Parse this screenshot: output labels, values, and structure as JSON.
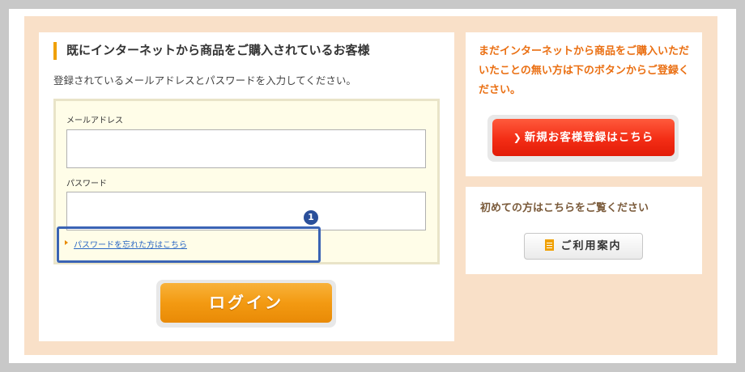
{
  "login": {
    "heading": "既にインターネットから商品をご購入されているお客様",
    "instruction": "登録されているメールアドレスとパスワードを入力してください。",
    "email_label": "メールアドレス",
    "email_value": "",
    "password_label": "パスワード",
    "password_value": "",
    "forgot_link": "パスワードを忘れた方はこちら",
    "annotation_number": "1",
    "login_button": "ログイン"
  },
  "new_customer": {
    "message": "まだインターネットから商品をご購入いただいたことの無い方は下のボタンからご登録ください。",
    "register_button": "新規お客様登録はこちら"
  },
  "guide": {
    "title": "初めての方はこちらをご覧ください",
    "button": "ご利用案内"
  },
  "colors": {
    "accent_orange": "#f39a12",
    "register_red": "#f32d15",
    "annotation_blue": "#3a63b4",
    "link_blue": "#2a67c4"
  }
}
